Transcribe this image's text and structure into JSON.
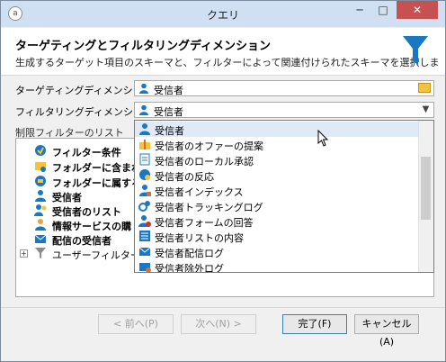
{
  "window": {
    "title": "クエリ",
    "min": "─",
    "max": "□",
    "close": "✕"
  },
  "header": {
    "title": "ターゲティングとフィルタリングディメンション",
    "subtitle": "生成するターゲット項目のスキーマと、フィルターによって関連付けられたスキーマを選択しま"
  },
  "form": {
    "targeting_label": "ターゲティングディメンション:",
    "targeting_value": "受信者",
    "filtering_label": "フィルタリングディメンション:",
    "filtering_value": "受信者"
  },
  "restriction": {
    "label": "制限フィルターのリスト",
    "items": [
      {
        "label": "フィルター条件",
        "icon": "filter-conditions-icon"
      },
      {
        "label": "フォルダーに含まれ",
        "icon": "folder-icon"
      },
      {
        "label": "フォルダーに属する",
        "icon": "folder-icon"
      },
      {
        "label": "受信者",
        "icon": "recipient-icon"
      },
      {
        "label": "受信者のリスト",
        "icon": "recipient-list-icon"
      },
      {
        "label": "情報サービスの購",
        "icon": "subscription-icon"
      },
      {
        "label": "配信の受信者",
        "icon": "mail-icon"
      },
      {
        "label": "ユーザーフィルター",
        "icon": "funnel-icon"
      }
    ]
  },
  "dropdown": {
    "items": [
      {
        "label": "受信者",
        "icon": "person-icon"
      },
      {
        "label": "受信者のオファーの提案",
        "icon": "gift-icon"
      },
      {
        "label": "受信者のローカル承認",
        "icon": "document-icon"
      },
      {
        "label": "受信者の反応",
        "icon": "reaction-icon"
      },
      {
        "label": "受信者インデックス",
        "icon": "person-index-icon"
      },
      {
        "label": "受信者トラッキングログ",
        "icon": "tracking-icon"
      },
      {
        "label": "受信者フォームの回答",
        "icon": "form-icon"
      },
      {
        "label": "受信者リストの内容",
        "icon": "list-content-icon"
      },
      {
        "label": "受信者配信ログ",
        "icon": "delivery-log-icon"
      },
      {
        "label": "受信者除外ログ",
        "icon": "exclusion-log-icon"
      }
    ]
  },
  "buttons": {
    "back": "< 前へ(P)",
    "next": "次へ(N) >",
    "finish": "完了(F)",
    "cancel": "キャンセル(A)"
  },
  "colors": {
    "accent": "#1a78c2",
    "titlebar": "#cfe0f2",
    "close": "#c75050"
  }
}
